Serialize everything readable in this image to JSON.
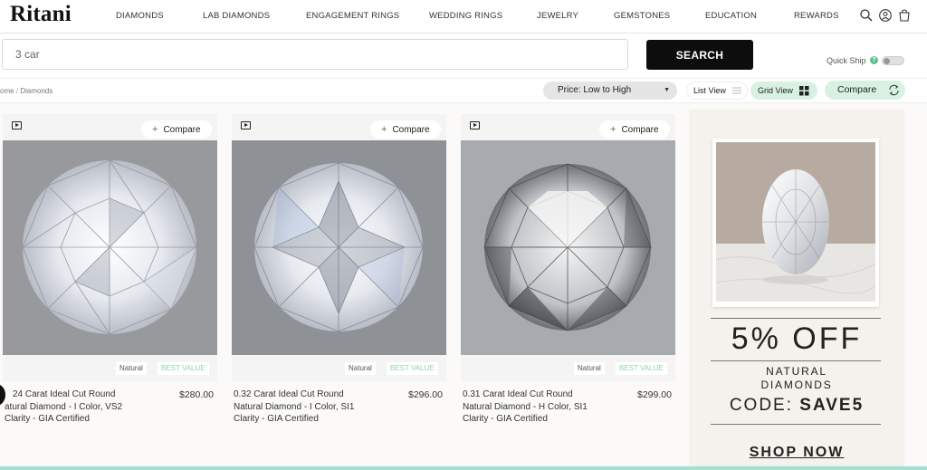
{
  "nav": {
    "logo": "Ritani",
    "items": [
      "DIAMONDS",
      "LAB DIAMONDS",
      "ENGAGEMENT RINGS",
      "WEDDING RINGS",
      "JEWELRY",
      "GEMSTONES",
      "EDUCATION",
      "REWARDS"
    ],
    "icons": [
      "search-icon",
      "account-icon",
      "cart-icon"
    ]
  },
  "search": {
    "value": "3 car",
    "button_label": "SEARCH"
  },
  "quickship": {
    "label": "Quick Ship",
    "help": "?"
  },
  "breadcrumb": {
    "home": "ome",
    "sep": " / ",
    "current": "Diamonds"
  },
  "toolbar": {
    "sort_label": "Price: Low to High",
    "list_view": "List View",
    "grid_view": "Grid View",
    "compare": "Compare"
  },
  "products": [
    {
      "compare_label": "Compare",
      "tag_natural": "Natural",
      "tag_value": "BEST VALUE",
      "title_line1": "24 Carat Ideal Cut Round",
      "title_line2": "atural Diamond - I Color, VS2",
      "title_line3": "Clarity - GIA Certified",
      "price": "$280.00"
    },
    {
      "compare_label": "Compare",
      "tag_natural": "Natural",
      "tag_value": "BEST VALUE",
      "title_line1": "0.32 Carat Ideal Cut Round",
      "title_line2": "Natural Diamond - I Color, SI1",
      "title_line3": "Clarity - GIA Certified",
      "price": "$296.00"
    },
    {
      "compare_label": "Compare",
      "tag_natural": "Natural",
      "tag_value": "BEST VALUE",
      "title_line1": "0.31 Carat Ideal Cut Round",
      "title_line2": "Natural Diamond - H Color, SI1",
      "title_line3": "Clarity - GIA Certified",
      "price": "$299.00"
    }
  ],
  "promo": {
    "headline": "5% OFF",
    "line1": "NATURAL",
    "line2": "DIAMONDS",
    "code_label": "CODE: ",
    "code": "SAVE5",
    "cta": "SHOP NOW"
  },
  "colors": {
    "accent_green": "#d7f2e3",
    "best_value": "#8fd6ad",
    "search_button": "#0d0d0d"
  }
}
